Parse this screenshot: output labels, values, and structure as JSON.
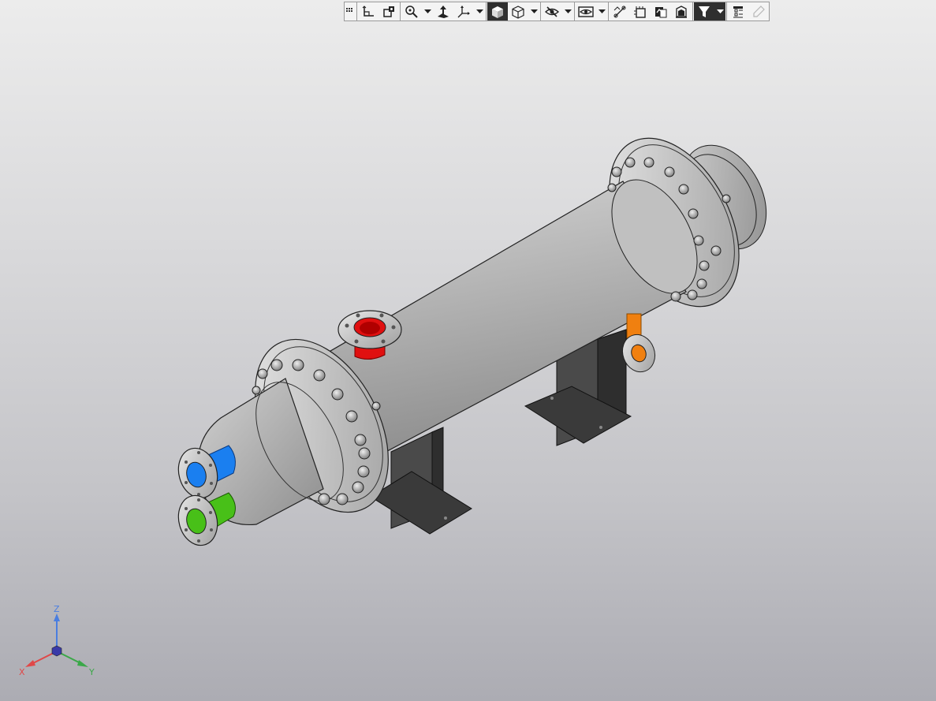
{
  "toolbar": {
    "buttons": [
      {
        "name": "grip-handle",
        "icon": "grip-icon"
      },
      {
        "name": "sketch-plane-button",
        "icon": "sketch-plane-icon"
      },
      {
        "name": "section-view-button",
        "icon": "section-view-icon"
      },
      {
        "name": "zoom-button",
        "icon": "zoom-icon"
      },
      {
        "name": "zoom-dropdown",
        "icon": "chevron-down-icon"
      },
      {
        "name": "normal-to-button",
        "icon": "normal-to-icon"
      },
      {
        "name": "view-orientation-button",
        "icon": "axes-icon"
      },
      {
        "name": "view-orientation-dropdown",
        "icon": "chevron-down-icon"
      },
      {
        "name": "shaded-with-edges-button",
        "icon": "shaded-cube-icon"
      },
      {
        "name": "wireframe-button",
        "icon": "wireframe-cube-icon"
      },
      {
        "name": "display-style-dropdown",
        "icon": "chevron-down-icon"
      },
      {
        "name": "hide-show-button",
        "icon": "eye-slash-icon"
      },
      {
        "name": "hide-show-dropdown",
        "icon": "chevron-down-icon"
      },
      {
        "name": "view-settings-button",
        "icon": "eye-box-icon"
      },
      {
        "name": "view-settings-dropdown",
        "icon": "chevron-down-icon"
      },
      {
        "name": "measure-button",
        "icon": "measure-icon"
      },
      {
        "name": "perspective-button",
        "icon": "perspective-icon"
      },
      {
        "name": "appearance-button",
        "icon": "appearance-icon"
      },
      {
        "name": "scene-button",
        "icon": "scene-icon"
      },
      {
        "name": "filter-button",
        "icon": "filter-icon"
      },
      {
        "name": "filter-dropdown",
        "icon": "chevron-down-icon"
      },
      {
        "name": "properties-button",
        "icon": "properties-icon"
      },
      {
        "name": "edit-button",
        "icon": "pencil-icon"
      }
    ]
  },
  "triad": {
    "x_label": "X",
    "y_label": "Y",
    "z_label": "Z",
    "x_color": "#e04848",
    "y_color": "#3aa848",
    "z_color": "#4a7ee0"
  },
  "model": {
    "shell_color": "#b8b8b8",
    "nozzle_top_color": "#e01010",
    "nozzle_blue_color": "#1a7ff0",
    "nozzle_green_color": "#48c018",
    "nozzle_orange_color": "#f08010",
    "support_color": "#3a3a3a"
  }
}
